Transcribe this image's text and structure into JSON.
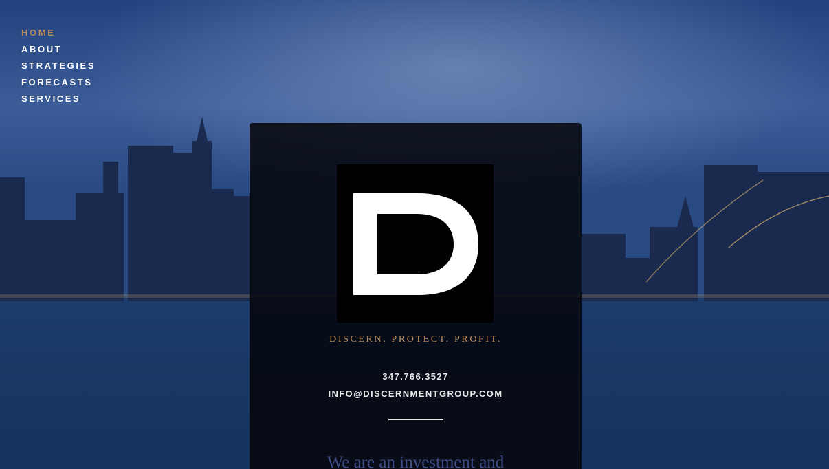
{
  "nav": {
    "items": [
      {
        "label": "HOME",
        "active": true
      },
      {
        "label": "ABOUT",
        "active": false
      },
      {
        "label": "STRATEGIES",
        "active": false
      },
      {
        "label": "FORECASTS",
        "active": false
      },
      {
        "label": "SERVICES",
        "active": false
      }
    ]
  },
  "hero": {
    "logo_letter": "D",
    "tagline": "DISCERN. PROTECT. PROFIT.",
    "phone": "347.766.3527",
    "email": "INFO@DISCERNMENTGROUP.COM",
    "intro_text": "We are an investment and"
  },
  "colors": {
    "accent": "#b88a5c",
    "panel": "#05060a",
    "text_light": "#e9e9ea",
    "intro_text": "#3f4c86",
    "sky": "#2a4a86",
    "water": "#1d3a66"
  },
  "background": "city-skyline-photo-at-dusk"
}
